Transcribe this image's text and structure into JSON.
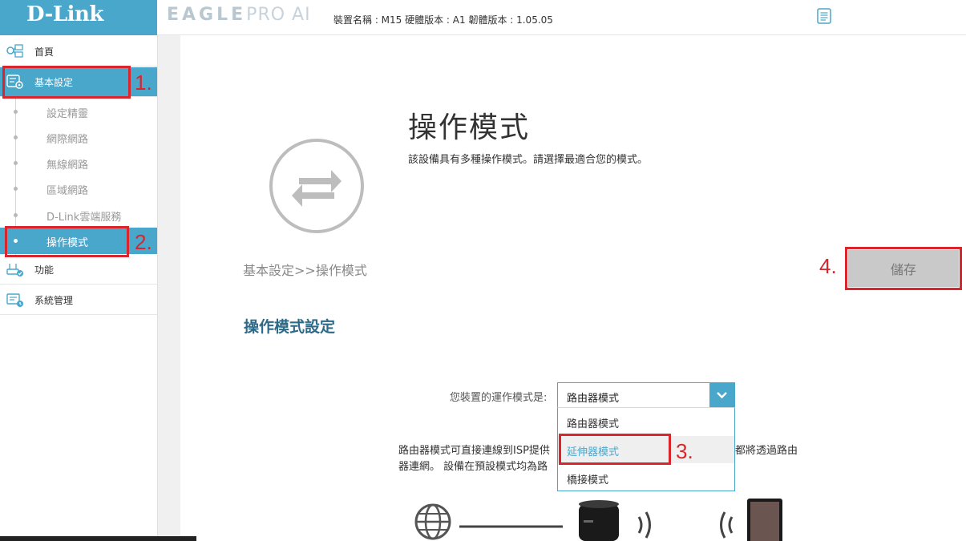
{
  "header": {
    "logo": "D-Link",
    "product_name_bold": "EAGLE",
    "product_name_light": "PRO AI",
    "device_info": "裝置名稱 : M15 硬體版本 : A1 韌體版本 : 1.05.05",
    "doc_icon": "document-icon"
  },
  "sidebar": {
    "items": [
      {
        "label": "首頁",
        "icon": "home-network-icon"
      },
      {
        "label": "基本設定",
        "icon": "settings-icon"
      },
      {
        "label": "功能",
        "icon": "router-check-icon"
      },
      {
        "label": "系統管理",
        "icon": "system-clock-icon"
      }
    ],
    "sub_items": [
      {
        "label": "設定精靈"
      },
      {
        "label": "網際網路"
      },
      {
        "label": "無線網路"
      },
      {
        "label": "區域網路"
      },
      {
        "label": "D-Link雲端服務"
      },
      {
        "label": "操作模式"
      }
    ]
  },
  "annotations": {
    "n1": "1.",
    "n2": "2.",
    "n3": "3.",
    "n4": "4.",
    "color": "#d9262c"
  },
  "main": {
    "title": "操作模式",
    "description": "該設備具有多種操作模式。請選擇最適合您的模式。",
    "breadcrumb": "基本設定>>操作模式",
    "save_label": "儲存",
    "section_title": "操作模式設定",
    "mode_label": "您裝置的運作模式是:",
    "mode_selected": "路由器模式",
    "mode_options": [
      "路由器模式",
      "延伸器模式",
      "橋接模式"
    ],
    "desc_line1a": "路由器模式可直接連線到ISP提供",
    "desc_line1b": "都將透過路由",
    "desc_line2": "器連網。 設備在預設模式均為路"
  },
  "colors": {
    "accent": "#4aa7cc",
    "save_disabled": "#c9c9c9",
    "section_title": "#2d6a87"
  }
}
